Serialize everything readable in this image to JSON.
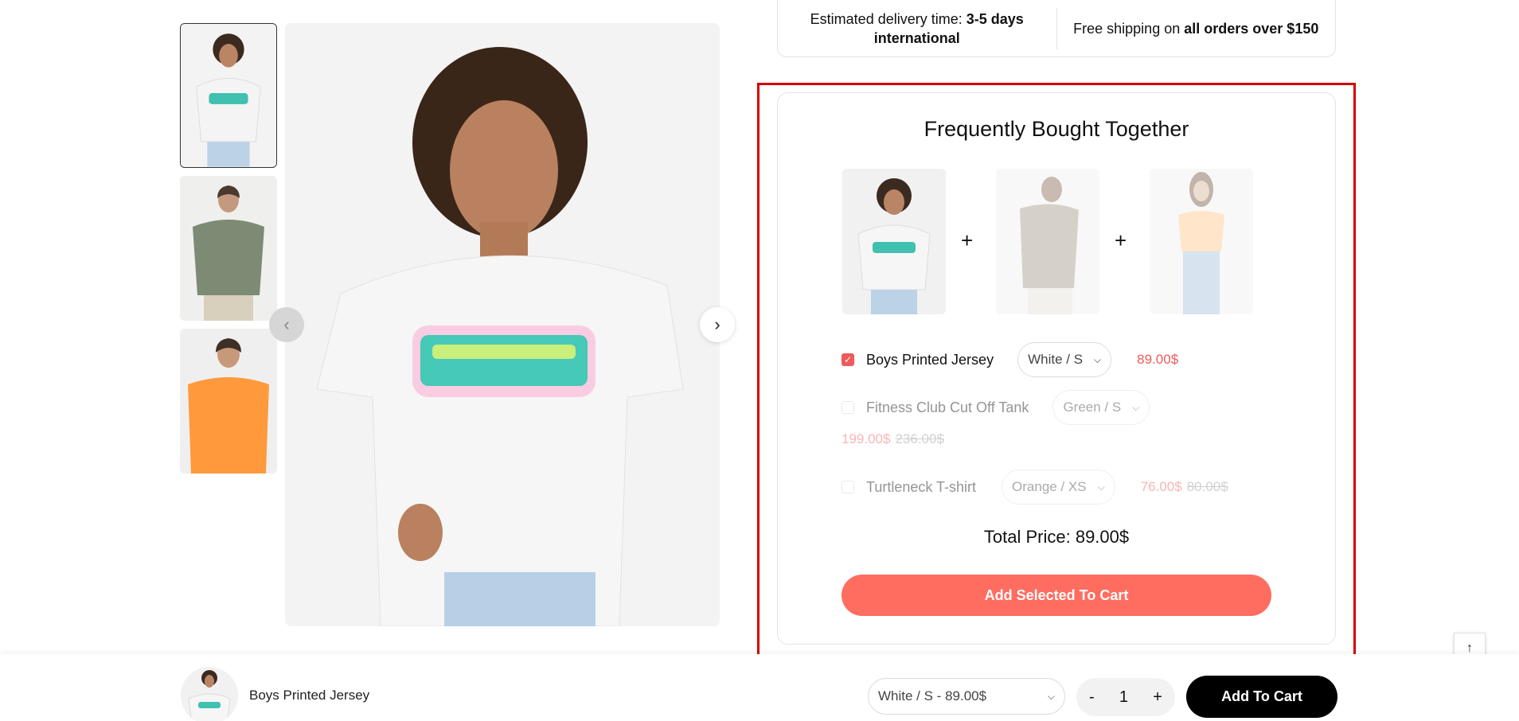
{
  "delivery": {
    "estimated_prefix": "Estimated delivery time:",
    "estimated_value": "3-5 days international",
    "shipping_prefix": "Free shipping on",
    "shipping_value": "all orders over $150"
  },
  "gallery": {
    "thumbnails": [
      {
        "name": "boy-white-graffiti-tee",
        "shirt_color": "#f4f4f4",
        "active": true
      },
      {
        "name": "man-olive-tee",
        "shirt_color": "#7d8a74",
        "active": false
      },
      {
        "name": "man-orange-tee",
        "shirt_color": "#ff9a3c",
        "active": false
      }
    ],
    "prev_icon": "chevron-left-icon",
    "next_icon": "chevron-right-icon"
  },
  "fbt": {
    "title": "Frequently Bought Together",
    "plus": "+",
    "products": [
      {
        "name": "Boys Printed Jersey",
        "variant": "White / S",
        "price": "89.00$",
        "old_price": "",
        "checked": true
      },
      {
        "name": "Fitness Club Cut Off Tank",
        "variant": "Green / S",
        "price": "199.00$",
        "old_price": "236.00$",
        "checked": false
      },
      {
        "name": "Turtleneck T-shirt",
        "variant": "Orange / XS",
        "price": "76.00$",
        "old_price": "80.00$",
        "checked": false
      }
    ],
    "total_label": "Total Price:",
    "total_value": "89.00$",
    "add_selected_label": "Add Selected To Cart"
  },
  "sticky": {
    "product_name": "Boys Printed Jersey",
    "variant_option": "White / S - 89.00$",
    "qty_minus": "-",
    "qty_value": "1",
    "qty_plus": "+",
    "add_to_cart_label": "Add To Cart"
  },
  "colors": {
    "accent": "#ff6d60",
    "price_red": "#ef5a5a",
    "highlight": "#d40000"
  }
}
